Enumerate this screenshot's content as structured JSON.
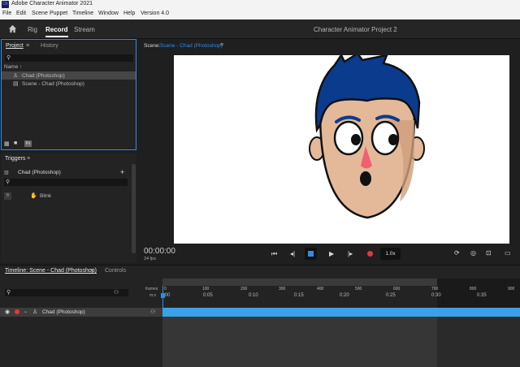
{
  "window": {
    "title": "Adobe Character Animator 2021",
    "app_icon": "Ch"
  },
  "menu": [
    "File",
    "Edit",
    "Scene",
    "Puppet",
    "Timeline",
    "Window",
    "Help",
    "Version 4.0"
  ],
  "workspace": {
    "tabs": [
      {
        "label": "Rig",
        "active": false
      },
      {
        "label": "Record",
        "active": true
      },
      {
        "label": "Stream",
        "active": false
      }
    ],
    "project_title": "Character Animator Project 2"
  },
  "project_panel": {
    "tabs": [
      {
        "label": "Project",
        "active": true
      },
      {
        "label": "History",
        "active": false
      }
    ],
    "menu_glyph": "≡",
    "name_header": "Name ↑",
    "items": [
      {
        "label": "Chad (Photoshop)",
        "icon": "puppet-icon",
        "selected": true
      },
      {
        "label": "Scene - Chad (Photoshop)",
        "icon": "scene-icon",
        "selected": false
      }
    ],
    "footer_icons": [
      "new-scene-icon",
      "folder-icon",
      "photoshop-icon"
    ],
    "footer_ps": "Ps"
  },
  "scene_panel": {
    "label_prefix": "Scene:",
    "scene_name": "Scene - Chad (Photoshop)",
    "menu_glyph": "≡",
    "timecode": "00:00:00",
    "fps": "24 fps",
    "speed": "1.0x"
  },
  "triggers_panel": {
    "title": "Triggers",
    "menu_glyph": "≡",
    "puppet": "Chad (Photoshop)",
    "add_glyph": "+",
    "trigger_key": "B",
    "trigger_label": "Blink"
  },
  "timeline_panel": {
    "tabs": [
      {
        "label": "Timeline: Scene - Chad (Photoshop)",
        "active": true
      },
      {
        "label": "Controls",
        "active": false
      }
    ],
    "menu_glyph": "≡",
    "frames_label": "frames",
    "time_label": "m:s",
    "frame_ticks": [
      "0",
      "100",
      "200",
      "300",
      "400",
      "500",
      "600",
      "700",
      "800",
      "900"
    ],
    "time_ticks": [
      ":00",
      "0:05",
      "0:10",
      "0:15",
      "0:20",
      "0:25",
      "0:30",
      "0:35"
    ],
    "track_label": "Chad (Photoshop)"
  },
  "colors": {
    "accent": "#2d8ceb",
    "track": "#3aa2e6",
    "hair": "#0b3b8c",
    "skin": "#e3b99a",
    "record": "#e03a3a",
    "nose": "#f06070"
  }
}
